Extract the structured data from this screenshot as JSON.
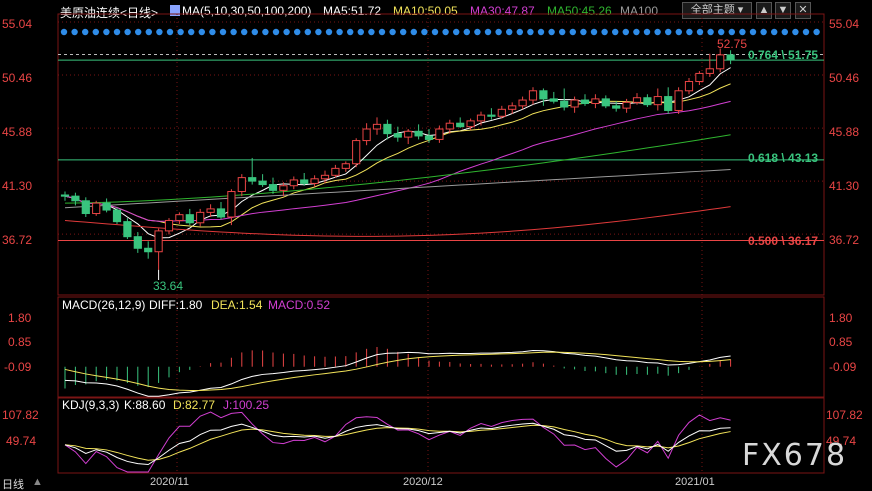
{
  "header": {
    "title": "美原油连续<日线>",
    "ma_label": "MA(5,10,30,50,100,200)",
    "ma5": "MA5:51.72",
    "ma10": "MA10:50.05",
    "ma30": "MA30:47.87",
    "ma50": "MA50:45.26",
    "ma100": "MA100",
    "theme_button": "全部主题",
    "theme_icon": "dropdown-arrow-icon",
    "nav_up_icon": "arrow-up-icon",
    "nav_down_icon": "arrow-down-icon",
    "close_icon": "close-icon"
  },
  "macd_label": {
    "name": "MACD(26,12,9)",
    "dif": "DIFF:1.80",
    "dea": "DEA:1.54",
    "macd": "MACD:0.52"
  },
  "kdj_label": {
    "name": "KDJ(9,3,3)",
    "k": "K:88.60",
    "d": "D:82.77",
    "j": "J:100.25"
  },
  "price_axis": [
    "55.04",
    "50.46",
    "45.88",
    "41.30",
    "36.72"
  ],
  "macd_axis": [
    "1.80",
    "0.85",
    "-0.09"
  ],
  "kdj_axis": [
    "107.82",
    "49.74"
  ],
  "fib_labels": {
    "l764": "0.764 \\ 51.75",
    "l618": "0.618 \\ 43.13",
    "l500": "0.500 \\ 36.17"
  },
  "low_label": "33.64",
  "high_label": "52.75",
  "date_labels": [
    "2020/11",
    "2020/12",
    "2021/01"
  ],
  "bottom_tab": "日线",
  "watermark": "FX678",
  "colors": {
    "up": "#e94545",
    "down": "#39c47e",
    "ma5": "#ffffff",
    "ma10": "#f2e35a",
    "ma30": "#d23fd2",
    "ma50": "#2fb52f",
    "ma100": "#9a9a9a",
    "ma200": "#e03a3a",
    "grid": "#7a1515"
  },
  "chart_data": {
    "type": "candlestick",
    "title": "美原油连续<日线>",
    "ylim": [
      32.5,
      55.04
    ],
    "candles": [
      [
        40.1,
        40.4,
        39.6,
        40.0
      ],
      [
        40.0,
        40.3,
        39.2,
        39.6
      ],
      [
        39.6,
        39.9,
        38.2,
        38.5
      ],
      [
        38.5,
        39.6,
        38.3,
        39.4
      ],
      [
        39.4,
        39.8,
        38.6,
        38.8
      ],
      [
        38.8,
        39.0,
        37.6,
        37.8
      ],
      [
        37.8,
        38.1,
        36.3,
        36.5
      ],
      [
        36.5,
        36.9,
        35.1,
        35.5
      ],
      [
        35.5,
        36.1,
        34.6,
        35.2
      ],
      [
        35.2,
        37.2,
        33.64,
        37.0
      ],
      [
        37.0,
        38.1,
        36.7,
        37.9
      ],
      [
        37.9,
        38.6,
        37.6,
        38.4
      ],
      [
        38.4,
        38.9,
        37.5,
        37.7
      ],
      [
        37.7,
        38.9,
        37.4,
        38.6
      ],
      [
        38.6,
        39.3,
        38.2,
        38.9
      ],
      [
        38.9,
        39.5,
        38.0,
        38.2
      ],
      [
        38.2,
        40.6,
        37.5,
        40.4
      ],
      [
        40.4,
        41.9,
        40.0,
        41.6
      ],
      [
        41.6,
        43.3,
        41.0,
        41.3
      ],
      [
        41.3,
        41.9,
        40.8,
        41.0
      ],
      [
        41.0,
        41.6,
        40.2,
        40.5
      ],
      [
        40.5,
        41.2,
        40.0,
        40.9
      ],
      [
        40.9,
        41.7,
        40.6,
        41.4
      ],
      [
        41.4,
        42.0,
        40.9,
        41.1
      ],
      [
        41.1,
        41.8,
        40.8,
        41.5
      ],
      [
        41.5,
        42.2,
        41.1,
        41.8
      ],
      [
        41.8,
        42.7,
        41.6,
        42.4
      ],
      [
        42.4,
        43.0,
        42.1,
        42.8
      ],
      [
        42.8,
        45.0,
        42.5,
        44.8
      ],
      [
        44.8,
        46.3,
        44.4,
        45.8
      ],
      [
        45.8,
        46.8,
        45.3,
        46.2
      ],
      [
        46.2,
        46.6,
        44.9,
        45.4
      ],
      [
        45.4,
        46.0,
        44.7,
        45.1
      ],
      [
        45.1,
        45.8,
        44.5,
        45.6
      ],
      [
        45.6,
        46.2,
        44.9,
        45.2
      ],
      [
        45.2,
        45.8,
        44.6,
        44.9
      ],
      [
        44.9,
        46.1,
        44.6,
        45.8
      ],
      [
        45.8,
        46.6,
        45.4,
        46.3
      ],
      [
        46.3,
        46.8,
        45.9,
        46.0
      ],
      [
        46.0,
        46.7,
        45.7,
        46.5
      ],
      [
        46.5,
        47.3,
        46.1,
        47.0
      ],
      [
        47.0,
        47.6,
        46.6,
        46.9
      ],
      [
        46.9,
        47.8,
        46.7,
        47.5
      ],
      [
        47.5,
        48.1,
        47.1,
        47.8
      ],
      [
        47.8,
        48.6,
        47.5,
        48.3
      ],
      [
        48.3,
        49.4,
        47.9,
        49.1
      ],
      [
        49.1,
        49.3,
        47.8,
        48.4
      ],
      [
        48.4,
        49.0,
        48.0,
        48.2
      ],
      [
        48.2,
        49.3,
        47.4,
        47.7
      ],
      [
        47.7,
        48.6,
        47.2,
        48.3
      ],
      [
        48.3,
        48.8,
        47.8,
        48.0
      ],
      [
        48.0,
        48.8,
        47.6,
        48.4
      ],
      [
        48.4,
        48.7,
        47.6,
        47.8
      ],
      [
        47.8,
        48.2,
        47.3,
        47.6
      ],
      [
        47.6,
        48.4,
        47.2,
        48.1
      ],
      [
        48.1,
        48.9,
        47.9,
        48.5
      ],
      [
        48.5,
        48.8,
        47.7,
        47.9
      ],
      [
        47.9,
        49.3,
        47.4,
        48.6
      ],
      [
        48.6,
        49.4,
        47.1,
        47.4
      ],
      [
        47.4,
        49.4,
        47.1,
        49.1
      ],
      [
        49.1,
        50.2,
        48.8,
        49.9
      ],
      [
        49.9,
        50.8,
        49.6,
        50.6
      ],
      [
        50.6,
        52.3,
        50.3,
        51.0
      ],
      [
        51.0,
        52.75,
        50.7,
        52.2
      ],
      [
        52.2,
        52.6,
        51.4,
        51.8
      ]
    ],
    "fib_levels": [
      {
        "ratio": "0.764",
        "value": 51.75
      },
      {
        "ratio": "0.618",
        "value": 43.13
      },
      {
        "ratio": "0.500",
        "value": 36.17
      }
    ],
    "macd": {
      "dif": 1.8,
      "dea": 1.54,
      "macd": 0.52,
      "ylim": [
        -0.9,
        2.2
      ]
    },
    "kdj": {
      "k": 88.6,
      "d": 82.77,
      "j": 100.25,
      "ylim": [
        0,
        125
      ]
    },
    "x_tick_labels": [
      "2020/11",
      "2020/12",
      "2021/01"
    ]
  }
}
